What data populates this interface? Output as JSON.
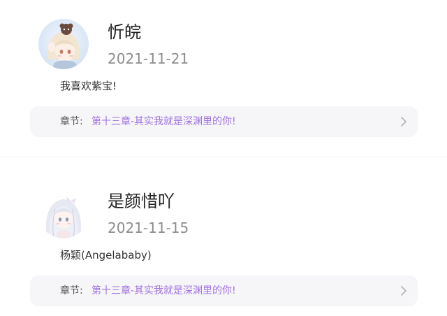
{
  "comments": [
    {
      "username": "忻皖",
      "date": "2021-11-21",
      "content": "我喜欢紫宝!",
      "chapter_label": "章节:",
      "chapter_title": "第十三章-其实我就是深渊里的你!"
    },
    {
      "username": "是颜惜吖",
      "date": "2021-11-15",
      "content": "杨颖(Angelababy)",
      "chapter_label": "章节:",
      "chapter_title": "第十三章-其实我就是深渊里的你!"
    }
  ],
  "colors": {
    "accent": "#a173e0",
    "chapter_bar_bg": "#f6f6f8",
    "date": "#8d8d8d"
  },
  "icons": {
    "chevron": "chevron-right-icon"
  }
}
